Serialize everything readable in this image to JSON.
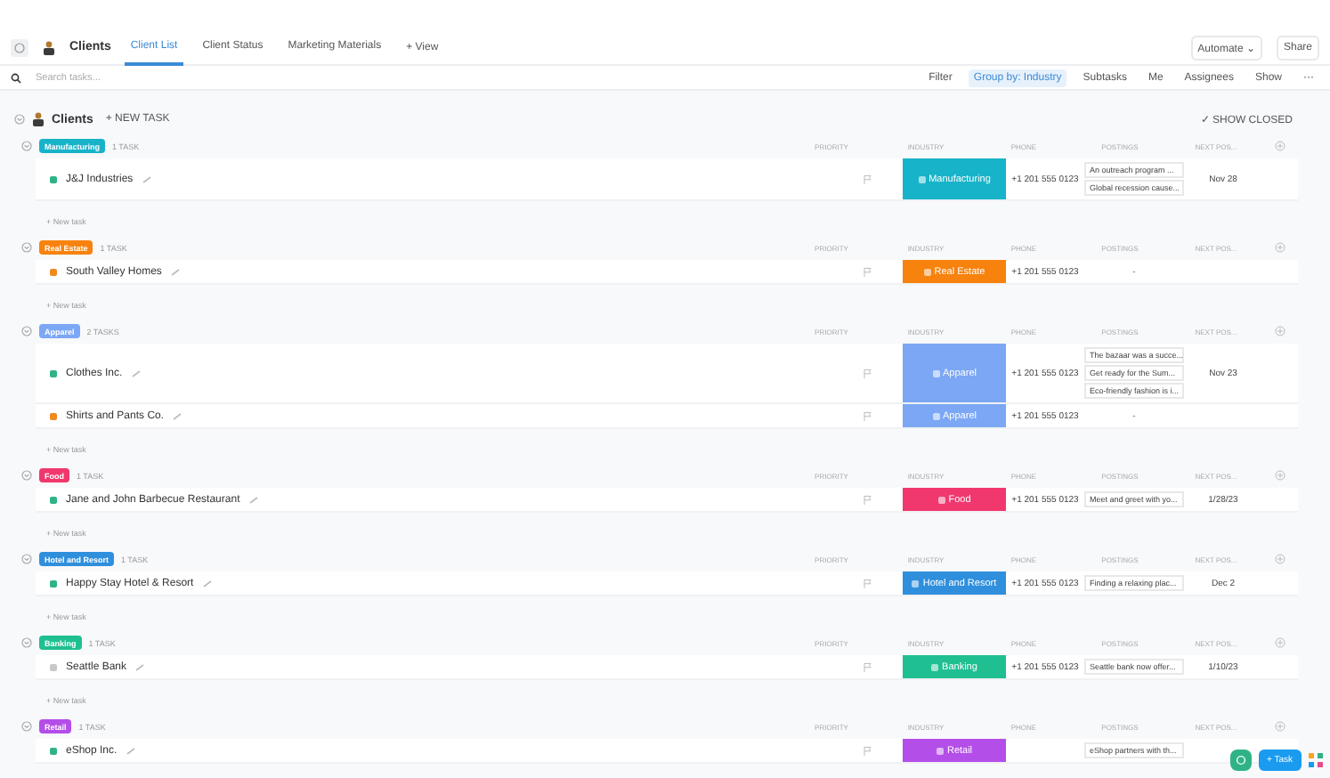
{
  "header": {
    "title": "Clients",
    "tabs": [
      {
        "label": "Client List",
        "selected": true
      },
      {
        "label": "Client Status",
        "selected": false
      },
      {
        "label": "Marketing Materials",
        "selected": false
      }
    ],
    "add_view": "+ View",
    "automate": "Automate",
    "automate_caret": "⌄",
    "share": "Share"
  },
  "toolbar": {
    "search": {
      "placeholder": "Search tasks..."
    },
    "filter": "Filter",
    "group_by": "Group by: Industry",
    "subtasks": "Subtasks",
    "me": "Me",
    "assignees": "Assignees",
    "show": "Show",
    "more": "···"
  },
  "list": {
    "title": "Clients",
    "new_task": "+ NEW TASK",
    "show_closed": "✓ SHOW CLOSED"
  },
  "groups": [
    {
      "name": "Manufacturing",
      "color": "#17b3c9",
      "count": "1 TASK",
      "columns": [
        "PRIORITY",
        "INDUSTRY",
        "PHONE",
        "POSTINGS",
        "NEXT POS..."
      ],
      "new_task": "+ New task",
      "rows": [
        {
          "name": "J&J Industries",
          "color": "#2fb386",
          "industry": "Manufacturing",
          "phone": "+1 201 555 0123",
          "postings": [
            "An outreach program ...",
            "Global recession cause..."
          ],
          "next": "Nov 28"
        }
      ]
    },
    {
      "name": "Real Estate",
      "color": "#f7820d",
      "count": "1 TASK",
      "columns": [
        "PRIORITY",
        "INDUSTRY",
        "PHONE",
        "POSTINGS",
        "NEXT POS..."
      ],
      "new_task": "+ New task",
      "rows": [
        {
          "name": "South Valley Homes",
          "color": "#f0891e",
          "industry": "Real Estate",
          "phone": "+1 201 555 0123",
          "postings": [
            "-"
          ],
          "next": ""
        }
      ]
    },
    {
      "name": "Apparel",
      "color": "#7ba7f5",
      "count": "2 TASKS",
      "columns": [
        "PRIORITY",
        "INDUSTRY",
        "PHONE",
        "POSTINGS",
        "NEXT POS..."
      ],
      "new_task": "+ New task",
      "rows": [
        {
          "name": "Clothes Inc.",
          "color": "#2fb386",
          "industry": "Apparel",
          "phone": "+1 201 555 0123",
          "postings": [
            "The bazaar was a succe...",
            "Get ready for the Sum...",
            "Eco-friendly fashion is i..."
          ],
          "next": "Nov 23"
        },
        {
          "name": "Shirts and Pants Co.",
          "color": "#f0891e",
          "industry": "Apparel",
          "phone": "+1 201 555 0123",
          "postings": [
            "-"
          ],
          "next": ""
        }
      ]
    },
    {
      "name": "Food",
      "color": "#f1386e",
      "count": "1 TASK",
      "columns": [
        "PRIORITY",
        "INDUSTRY",
        "PHONE",
        "POSTINGS",
        "NEXT POS..."
      ],
      "new_task": "+ New task",
      "rows": [
        {
          "name": "Jane and John Barbecue Restaurant",
          "color": "#2fb386",
          "industry": "Food",
          "phone": "+1 201 555 0123",
          "postings": [
            "Meet and greet with yo..."
          ],
          "next": "1/28/23"
        }
      ]
    },
    {
      "name": "Hotel and Resort",
      "color": "#2f8fdc",
      "count": "1 TASK",
      "columns": [
        "PRIORITY",
        "INDUSTRY",
        "PHONE",
        "POSTINGS",
        "NEXT POS..."
      ],
      "new_task": "+ New task",
      "rows": [
        {
          "name": "Happy Stay Hotel & Resort",
          "color": "#2fb386",
          "industry": "Hotel and Resort",
          "phone": "+1 201 555 0123",
          "postings": [
            "Finding a relaxing plac..."
          ],
          "next": "Dec 2"
        }
      ]
    },
    {
      "name": "Banking",
      "color": "#1fbf91",
      "count": "1 TASK",
      "columns": [
        "PRIORITY",
        "INDUSTRY",
        "PHONE",
        "POSTINGS",
        "NEXT POS..."
      ],
      "new_task": "+ New task",
      "rows": [
        {
          "name": "Seattle Bank",
          "color": "#c8c8c8",
          "industry": "Banking",
          "phone": "+1 201 555 0123",
          "postings": [
            "Seattle bank now offer..."
          ],
          "next": "1/10/23"
        }
      ]
    },
    {
      "name": "Retail",
      "color": "#b44ee8",
      "count": "1 TASK",
      "columns": [
        "PRIORITY",
        "INDUSTRY",
        "PHONE",
        "POSTINGS",
        "NEXT POS..."
      ],
      "rows": [
        {
          "name": "eShop Inc.",
          "color": "#2fb386",
          "industry": "Retail",
          "phone": "",
          "postings": [
            "eShop partners with th..."
          ],
          "next": ""
        }
      ]
    }
  ],
  "fab": {
    "task": "+ Task"
  }
}
